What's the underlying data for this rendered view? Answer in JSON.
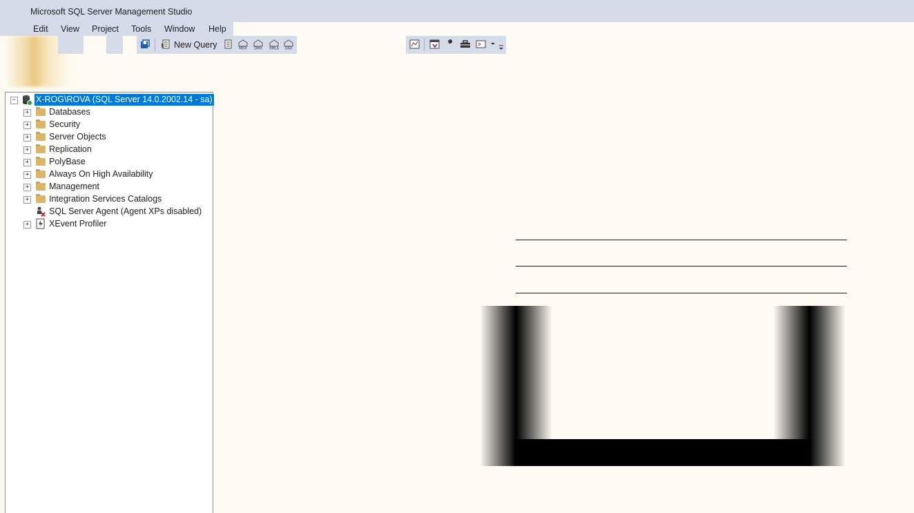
{
  "app": {
    "title": "Microsoft SQL Server Management Studio"
  },
  "menu": {
    "items": [
      "Edit",
      "View",
      "Project",
      "Tools",
      "Window",
      "Help"
    ]
  },
  "toolbar": {
    "new_query_label": "New Query",
    "mdx_label": "MDX",
    "dmx_label": "DMX",
    "xmla_label": "XMLA",
    "dax_label": "DAX"
  },
  "object_explorer": {
    "server_node": "X-ROG\\ROVA (SQL Server 14.0.2002.14 - sa)",
    "children": [
      {
        "label": "Databases",
        "icon": "folder-icon"
      },
      {
        "label": "Security",
        "icon": "folder-icon"
      },
      {
        "label": "Server Objects",
        "icon": "folder-icon"
      },
      {
        "label": "Replication",
        "icon": "folder-icon"
      },
      {
        "label": "PolyBase",
        "icon": "folder-icon"
      },
      {
        "label": "Always On High Availability",
        "icon": "folder-icon"
      },
      {
        "label": "Management",
        "icon": "folder-icon"
      },
      {
        "label": "Integration Services Catalogs",
        "icon": "folder-icon"
      },
      {
        "label": "SQL Server Agent (Agent XPs disabled)",
        "icon": "agent-disabled-icon"
      },
      {
        "label": "XEvent Profiler",
        "icon": "xevent-profiler-icon"
      }
    ]
  },
  "colors": {
    "accent": "#0078d7",
    "chrome": "#d6dbe9",
    "background": "#fffbf4"
  }
}
